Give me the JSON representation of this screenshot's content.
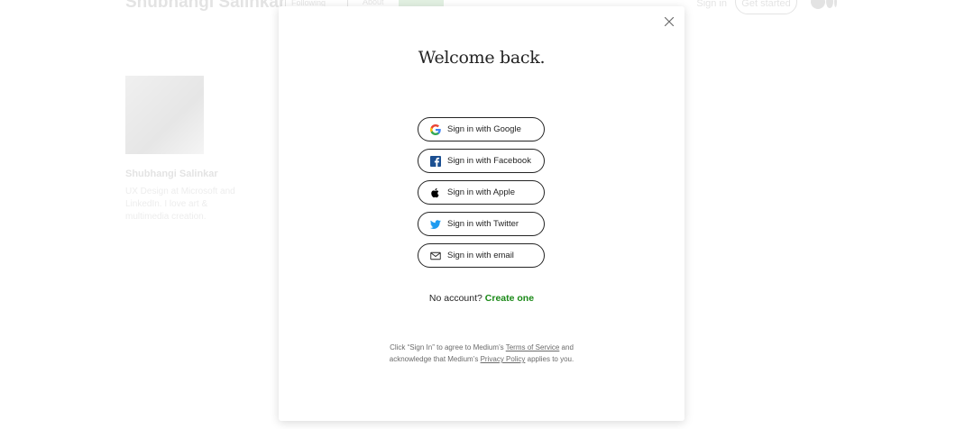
{
  "background_page": {
    "author_name": "Shubhangi Salinkar",
    "following_label": "Following",
    "about_label": "About",
    "follow_label": "Follow",
    "sign_in_label": "Sign in",
    "get_started_label": "Get started",
    "profile_name": "Shubhangi Salinkar",
    "profile_bio": "UX Design at Microsoft and LinkedIn. I love art & multimedia creation."
  },
  "modal": {
    "title": "Welcome back.",
    "close_icon": "close-icon",
    "auth_options": [
      {
        "label": "Sign in with Google",
        "icon": "google-icon"
      },
      {
        "label": "Sign in with Facebook",
        "icon": "facebook-icon"
      },
      {
        "label": "Sign in with Apple",
        "icon": "apple-icon"
      },
      {
        "label": "Sign in with Twitter",
        "icon": "twitter-icon"
      },
      {
        "label": "Sign in with email",
        "icon": "mail-icon"
      }
    ],
    "no_account_text": "No account?",
    "create_account_label": "Create one",
    "legal": {
      "prefix": "Click “Sign In” to agree to Medium’s",
      "terms_label": "Terms of Service",
      "middle": "and acknowledge that Medium’s",
      "privacy_label": "Privacy Policy",
      "suffix": "applies to you."
    }
  },
  "colors": {
    "accent_green": "#1a8917",
    "text_primary": "#242424",
    "text_secondary": "#6b6b6b",
    "facebook_blue": "#1877f2",
    "twitter_blue": "#1d9bf0"
  }
}
